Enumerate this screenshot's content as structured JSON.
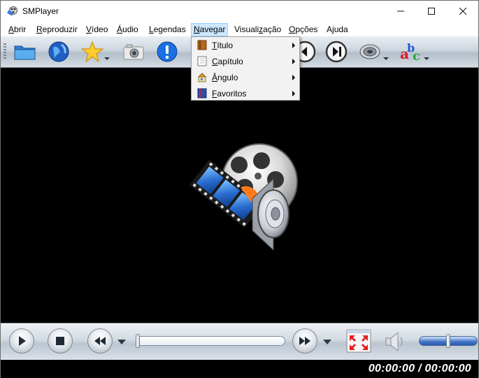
{
  "window": {
    "title": "SMPlayer",
    "controls": {
      "minimize": "─",
      "maximize": "☐",
      "close": "✕"
    }
  },
  "menubar": {
    "items": [
      {
        "label": "Abrir",
        "accel": "A"
      },
      {
        "label": "Reproduzir",
        "accel": "R"
      },
      {
        "label": "Vídeo",
        "accel": "V"
      },
      {
        "label": "Áudio",
        "accel": "Á"
      },
      {
        "label": "Legendas",
        "accel": "L"
      },
      {
        "label": "Navegar",
        "accel": "N",
        "active": true
      },
      {
        "label": "Visualização",
        "accel": "z"
      },
      {
        "label": "Opções",
        "accel": "O"
      },
      {
        "label": "Ajuda",
        "accel": "j"
      }
    ]
  },
  "toolbar": {
    "buttons": [
      "folder-icon",
      "globe-icon",
      "star-icon",
      "camera-icon",
      "info-icon",
      "previous-icon",
      "next-chapter-icon",
      "speaker-icon",
      "subtitles-icon"
    ]
  },
  "navegar_menu": {
    "items": [
      {
        "label": "Título",
        "accel": "T",
        "icon": "title-icon"
      },
      {
        "label": "Capítulo",
        "accel": "C",
        "icon": "chapter-icon"
      },
      {
        "label": "Ângulo",
        "accel": "Â",
        "icon": "angle-icon"
      },
      {
        "label": "Favoritos",
        "accel": "F",
        "icon": "favorites-icon"
      }
    ]
  },
  "controlbar": {
    "seek_position": 0.0,
    "volume_level": 0.5
  },
  "statusbar": {
    "time": "00:00:00 / 00:00:00"
  }
}
